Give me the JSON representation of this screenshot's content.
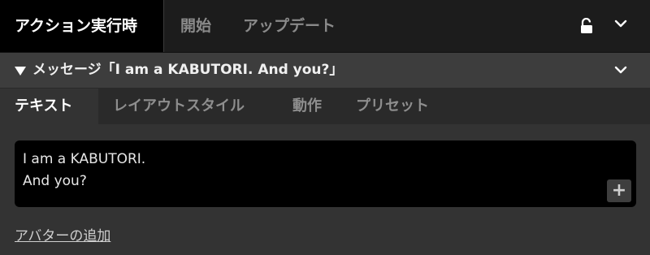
{
  "top_tabs": [
    {
      "label": "アクション実行時",
      "active": true
    },
    {
      "label": "開始",
      "active": false
    },
    {
      "label": "アップデート",
      "active": false
    }
  ],
  "icons": {
    "lock": "unlocked-padlock-icon",
    "collapse": "chevron-down-icon",
    "disclosure": "triangle-down-icon",
    "add": "plus-icon"
  },
  "message": {
    "title": "メッセージ「I am a KABUTORI. And you?」"
  },
  "sub_tabs": [
    {
      "label": "テキスト",
      "active": true
    },
    {
      "label": "レイアウトスタイル",
      "active": false
    },
    {
      "label": "動作",
      "active": false
    },
    {
      "label": "プリセット",
      "active": false
    }
  ],
  "text_field": {
    "lines": [
      "I am a KABUTORI.",
      "And you?"
    ],
    "add_label": "+"
  },
  "add_avatar_label": "アバターの追加",
  "colors": {
    "background": "#333333",
    "topbar": "#1c1c1c",
    "active_tab": "#000000",
    "inactive_text": "#8a8a8a"
  }
}
